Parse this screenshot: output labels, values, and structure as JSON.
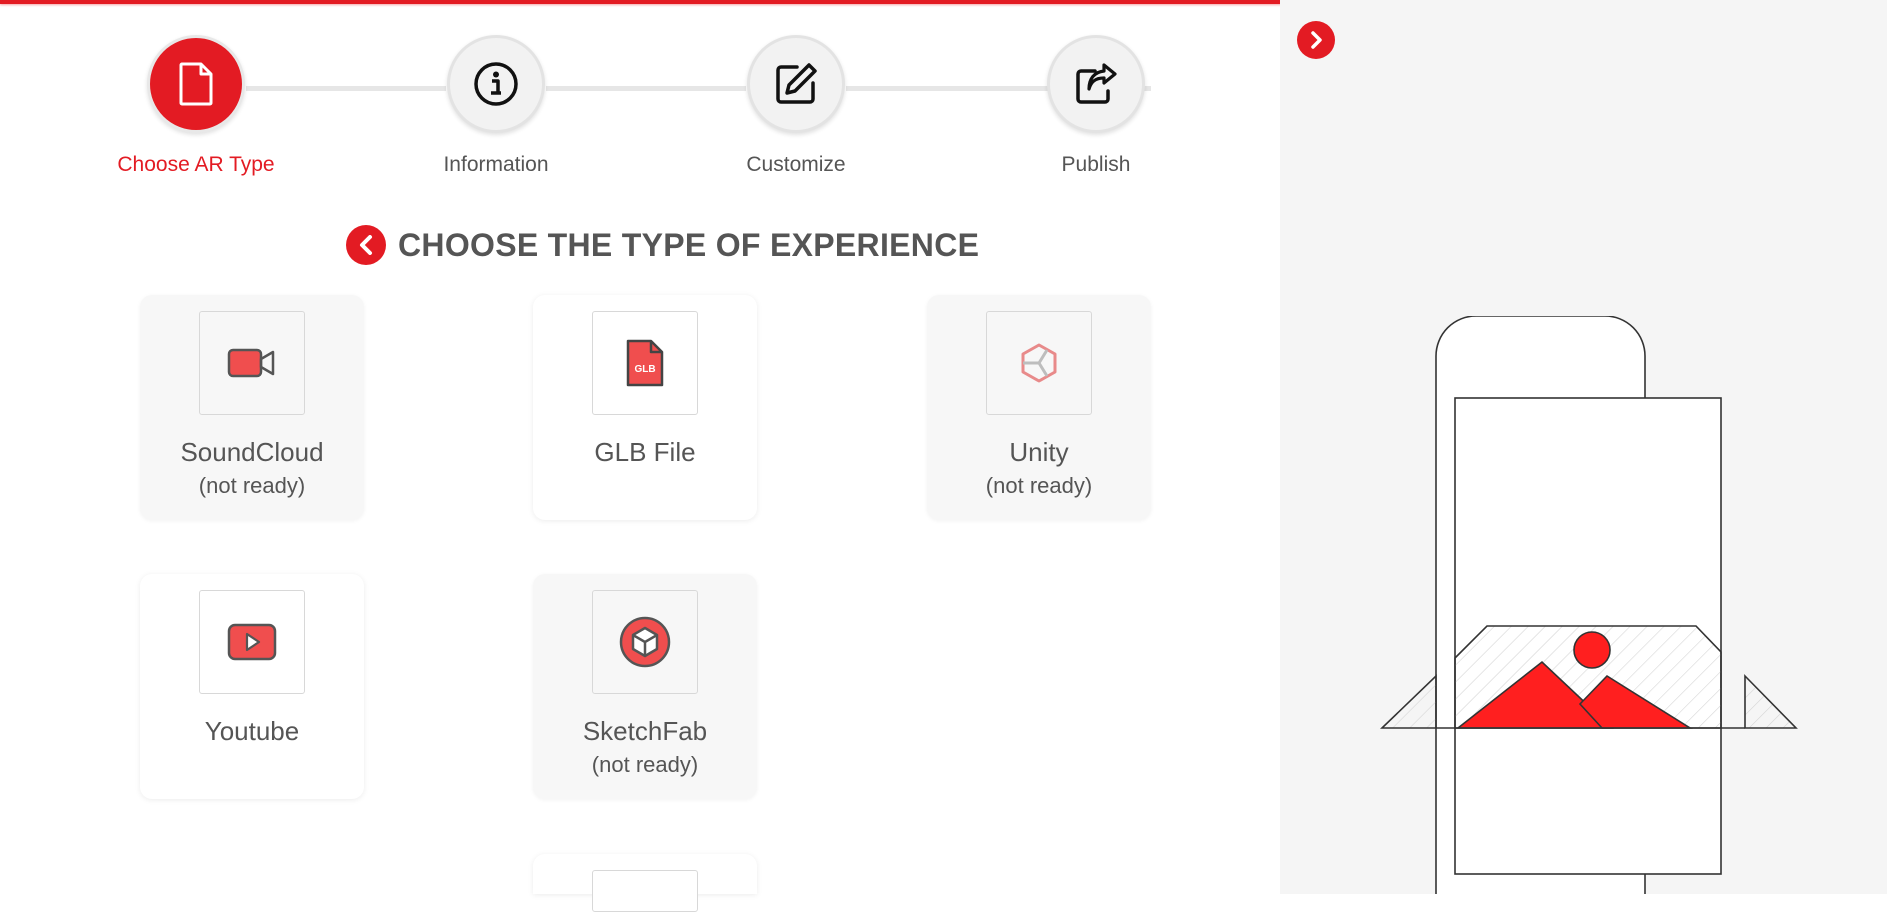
{
  "stepper": {
    "steps": [
      {
        "label": "Choose AR Type",
        "active": true,
        "icon": "file-icon"
      },
      {
        "label": "Information",
        "active": false,
        "icon": "info-icon"
      },
      {
        "label": "Customize",
        "active": false,
        "icon": "edit-icon"
      },
      {
        "label": "Publish",
        "active": false,
        "icon": "share-icon"
      }
    ]
  },
  "main": {
    "heading": "CHOOSE THE TYPE OF EXPERIENCE",
    "cards": [
      {
        "name": "SoundCloud",
        "status": "(not ready)",
        "icon": "video-camera-icon",
        "disabled": true
      },
      {
        "name": "GLB File",
        "status": "",
        "icon": "glb-file-icon",
        "disabled": false
      },
      {
        "name": "Unity",
        "status": "(not ready)",
        "icon": "unity-icon",
        "disabled": true
      },
      {
        "name": "Youtube",
        "status": "",
        "icon": "youtube-icon",
        "disabled": false
      },
      {
        "name": "SketchFab",
        "status": "(not ready)",
        "icon": "sketchfab-icon",
        "disabled": true
      }
    ]
  },
  "colors": {
    "accent": "#e31b23",
    "text": "#555555",
    "panel": "#f5f5f5"
  }
}
